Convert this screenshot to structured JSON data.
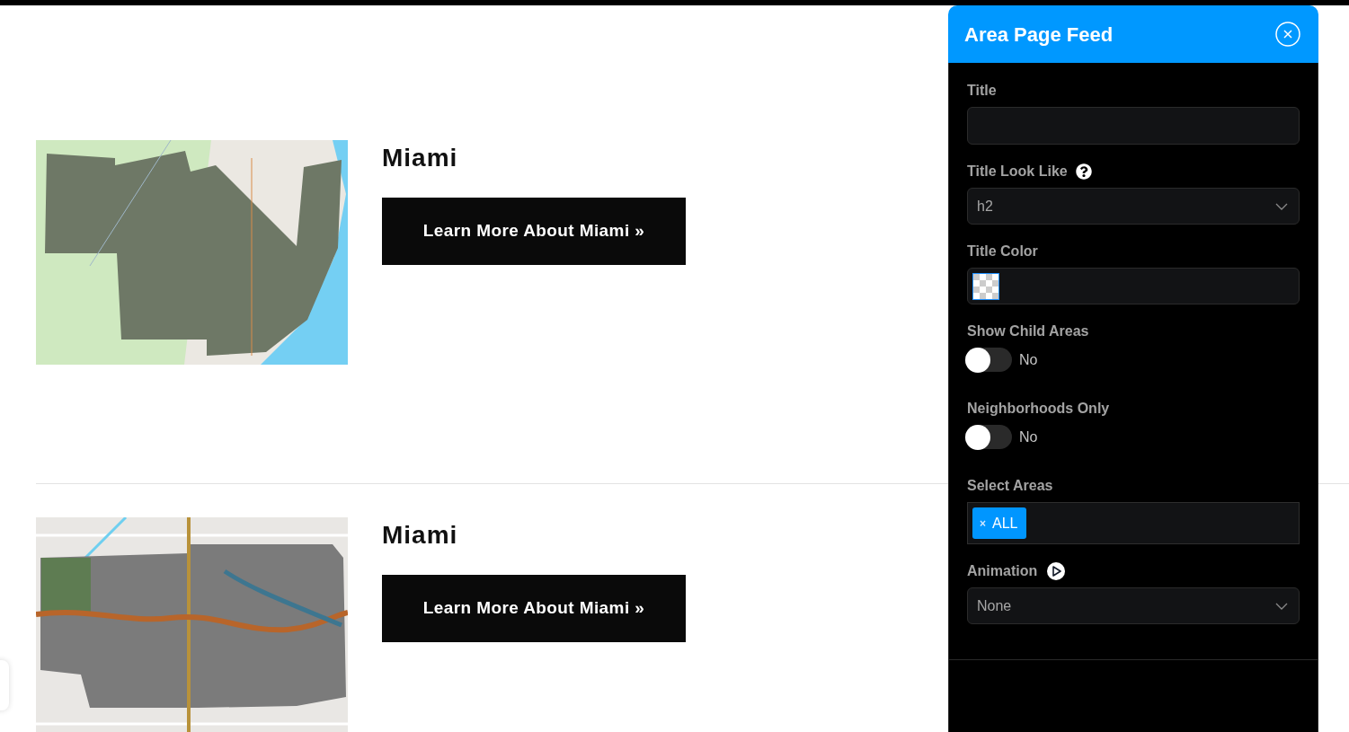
{
  "listings": [
    {
      "title": "Miami",
      "button": "Learn More About Miami »"
    },
    {
      "title": "Miami",
      "button": "Learn More About Miami »"
    }
  ],
  "panel": {
    "title": "Area Page Feed",
    "fields": [
      {
        "kind": "text",
        "label": "Title",
        "help": false,
        "preview": false
      },
      {
        "kind": "select",
        "label": "Title Look Like",
        "help": true,
        "preview": false,
        "value": "h2"
      },
      {
        "kind": "color",
        "label": "Title Color",
        "help": false,
        "preview": false
      },
      {
        "kind": "toggle",
        "label": "Show Child Areas",
        "help": false,
        "preview": false,
        "on": false,
        "value": "No"
      },
      {
        "kind": "toggle",
        "label": "Neighborhoods Only",
        "help": false,
        "preview": false,
        "on": false,
        "value": "No"
      },
      {
        "kind": "tags",
        "label": "Select Areas",
        "help": false,
        "preview": false,
        "tags": [
          {
            "label": "ALL",
            "remove": "×"
          }
        ]
      },
      {
        "kind": "select",
        "label": "Animation",
        "help": false,
        "preview": true,
        "value": "None"
      }
    ]
  }
}
